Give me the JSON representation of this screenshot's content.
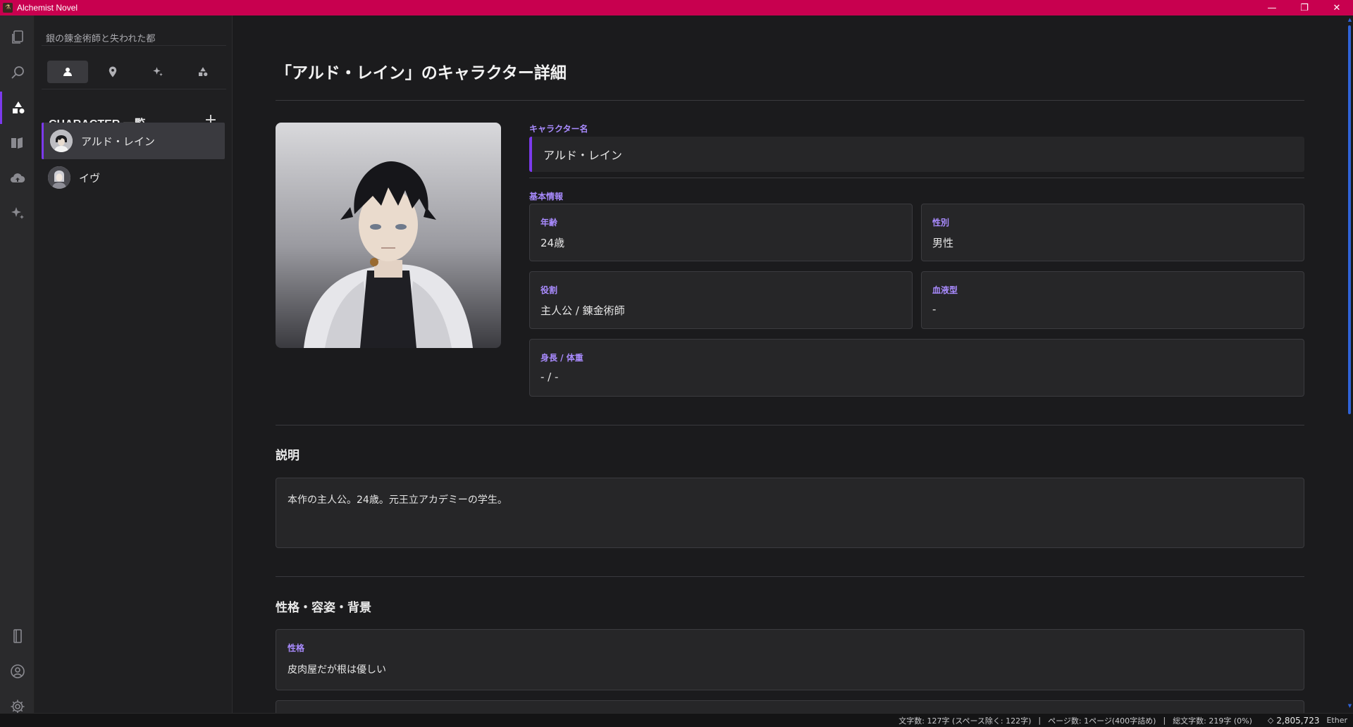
{
  "window": {
    "title": "Alchemist Novel",
    "app_icon": "alchemist-icon",
    "minimize": "—",
    "restore": "❐",
    "close": "✕"
  },
  "activity_bar": {
    "items": [
      {
        "name": "files-icon",
        "active": false
      },
      {
        "name": "search-icon",
        "active": false
      },
      {
        "name": "shapes-icon",
        "active": true
      },
      {
        "name": "book-icon",
        "active": false
      },
      {
        "name": "cloud-upload-icon",
        "active": false
      },
      {
        "name": "sparkles-icon",
        "active": false
      }
    ],
    "bottom": [
      "book-open-icon",
      "user-circle-icon",
      "gear-icon"
    ]
  },
  "sidebar": {
    "project_name": "銀の錬金術師と失われた都",
    "tabs": [
      "person-icon",
      "map-pin-icon",
      "sparkles-icon",
      "shapes-icon"
    ],
    "list_title": "CHARACTER 一覧",
    "add_label": "+",
    "characters": [
      {
        "name": "アルド・レイン",
        "selected": true
      },
      {
        "name": "イヴ",
        "selected": false
      }
    ]
  },
  "main": {
    "page_title": "「アルド・レイン」のキャラクター詳細",
    "name_label": "キャラクター名",
    "name_value": "アルド・レイン",
    "basic_label": "基本情報",
    "fields": {
      "age": {
        "label": "年齢",
        "value": "24歳"
      },
      "gender": {
        "label": "性別",
        "value": "男性"
      },
      "role": {
        "label": "役割",
        "value": "主人公 / 錬金術師"
      },
      "blood": {
        "label": "血液型",
        "value": "-"
      },
      "height_weight": {
        "label": "身長 / 体重",
        "value": "- / -"
      }
    },
    "description_title": "説明",
    "description_text": "本作の主人公。24歳。元王立アカデミーの学生。",
    "personality_section_title": "性格・容姿・背景",
    "personality_label": "性格",
    "personality_value": "皮肉屋だが根は優しい"
  },
  "statusbar": {
    "chars": "文字数: 127字 (スペース除く: 122字)",
    "pages": "ページ数: 1ページ(400字詰め)",
    "total": "総文字数: 219字 (0%)",
    "ether_count": "2,805,723",
    "ether_label": "Ether",
    "sep": "|"
  },
  "colors": {
    "titlebar": "#c8004f",
    "accent": "#7c3aed",
    "label": "#a98bff",
    "scroll": "#2f63d8"
  }
}
